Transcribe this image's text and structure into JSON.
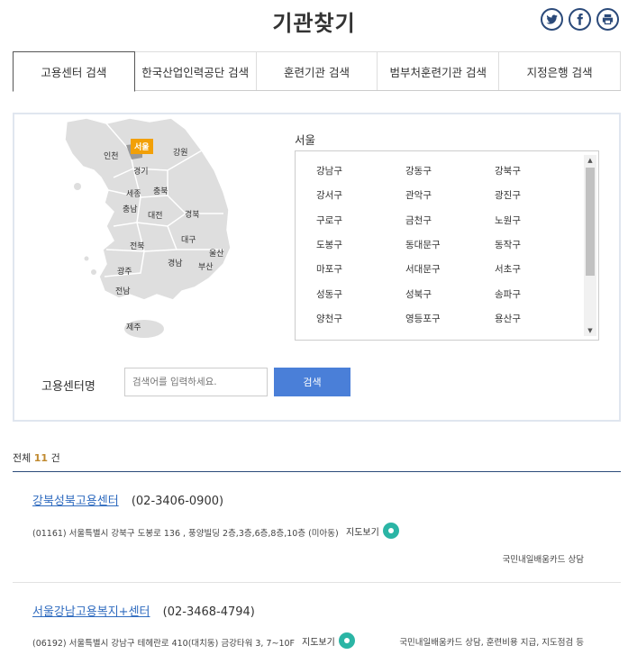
{
  "page": {
    "title": "기관찾기"
  },
  "share": {
    "twitter_icon": "twitter-icon",
    "facebook_icon": "facebook-icon",
    "print_icon": "print-icon"
  },
  "tabs": [
    {
      "label": "고용센터 검색",
      "active": true
    },
    {
      "label": "한국산업인력공단 검색",
      "active": false
    },
    {
      "label": "훈련기관 검색",
      "active": false
    },
    {
      "label": "범부처훈련기관 검색",
      "active": false
    },
    {
      "label": "지정은행 검색",
      "active": false
    }
  ],
  "map": {
    "regions": [
      "서울",
      "인천",
      "강원",
      "경기",
      "세종",
      "충북",
      "충남",
      "대전",
      "경북",
      "대구",
      "전북",
      "울산",
      "경남",
      "광주",
      "부산",
      "전남",
      "제주"
    ],
    "selected": "서울",
    "selected_color": "#f2a007"
  },
  "region": {
    "title": "서울",
    "districts": [
      "강남구",
      "강동구",
      "강북구",
      "강서구",
      "관악구",
      "광진구",
      "구로구",
      "금천구",
      "노원구",
      "도봉구",
      "동대문구",
      "동작구",
      "마포구",
      "서대문구",
      "서초구",
      "성동구",
      "성북구",
      "송파구",
      "양천구",
      "영등포구",
      "용산구"
    ]
  },
  "search": {
    "label": "고용센터명",
    "placeholder": "검색어를 입력하세요.",
    "button": "검색",
    "button_color": "#4a7fd8"
  },
  "summary": {
    "prefix": "전체",
    "count": "11",
    "suffix": "건"
  },
  "results": [
    {
      "name": "강북성북고용센터",
      "phone": "(02-3406-0900)",
      "address": "(01161) 서울특별시 강북구 도봉로 136 , 풍양빌딩 2층,3층,6층,8층,10층 (미아동)",
      "map_link": "지도보기",
      "service": "국민내일배움카드 상담"
    },
    {
      "name": "서울강남고용복지+센터",
      "phone": "(02-3468-4794)",
      "address": "(06192) 서울특별시 강남구 테헤란로 410(대치동) 금강타워 3, 7~10F",
      "map_link": "지도보기",
      "service": "국민내일배움카드 상담, 훈련비용 지급, 지도점검 등"
    }
  ]
}
